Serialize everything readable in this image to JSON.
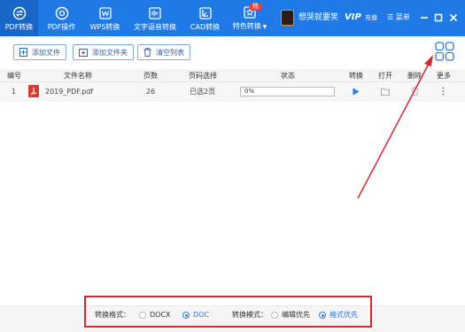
{
  "nav": {
    "items": [
      {
        "label": "PDF转换",
        "icon": "pdf-convert-icon"
      },
      {
        "label": "PDF操作",
        "icon": "pdf-operation-icon"
      },
      {
        "label": "WPS转换",
        "icon": "wps-icon"
      },
      {
        "label": "文字语音转换",
        "icon": "audio-wave-icon"
      },
      {
        "label": "CAD转换",
        "icon": "cad-icon"
      },
      {
        "label": "特色转换",
        "icon": "special-icon",
        "badge": "热"
      }
    ]
  },
  "user": {
    "name": "想哭就要笑",
    "vip": "VIP",
    "vip_sub": "充值",
    "menu": "菜单"
  },
  "toolbar": {
    "add_file": "添加文件",
    "add_folder": "添加文件夹",
    "clear": "清空列表"
  },
  "table": {
    "headers": {
      "num": "编号",
      "name": "文件名称",
      "pages": "页数",
      "select": "页码选择",
      "status": "状态",
      "convert": "转换",
      "open": "打开",
      "delete": "删除",
      "more": "更多"
    },
    "rows": [
      {
        "num": "1",
        "name": "2019_PDF.pdf",
        "pages": "26",
        "select": "已选2页",
        "progress": "0%"
      }
    ]
  },
  "bottom": {
    "format_label": "转换格式：",
    "format_options": [
      "DOCX",
      "DOC"
    ],
    "format_selected": "DOC",
    "mode_label": "转换模式：",
    "mode_options": [
      "编辑优先",
      "格式优先"
    ],
    "mode_selected": "格式优先"
  },
  "colors": {
    "accent": "#1f7ae8",
    "highlight": "#d8282f"
  }
}
